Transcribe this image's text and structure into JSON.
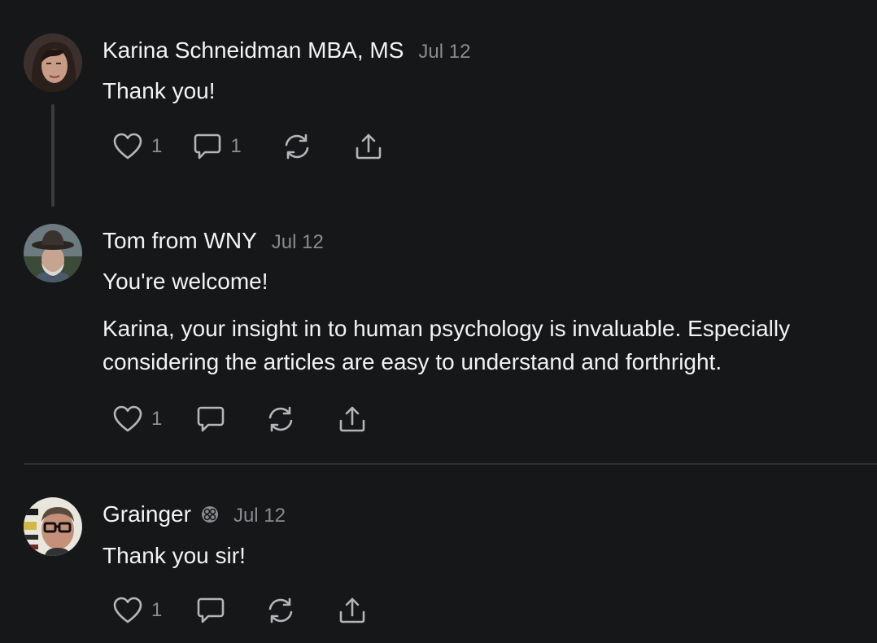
{
  "comments": [
    {
      "author": "Karina Schneidman MBA, MS",
      "date": "Jul 12",
      "paragraphs": [
        "Thank you!"
      ],
      "likes": "1",
      "replies": "1"
    },
    {
      "author": "Tom from WNY",
      "date": "Jul 12",
      "paragraphs": [
        "You're welcome!",
        "Karina, your insight in to human psychology is invaluable. Especially considering the articles are easy to understand and forthright."
      ],
      "likes": "1"
    },
    {
      "author": "Grainger",
      "date": "Jul 12",
      "paragraphs": [
        "Thank you sir!"
      ],
      "likes": "1"
    }
  ],
  "icons": {
    "like": "heart-icon",
    "reply": "comment-bubble-icon",
    "restack": "restack-icon",
    "share": "share-icon",
    "badge": "subscriber-badge-icon"
  },
  "colors": {
    "background": "#161719",
    "text": "#f2f2f2",
    "muted": "#8a8b8e",
    "icon": "#b4b5b8"
  }
}
